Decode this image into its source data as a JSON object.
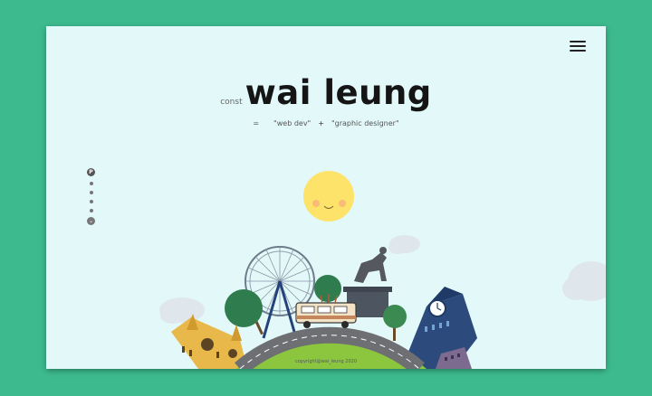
{
  "header": {
    "prefix": "const",
    "name": "wai leung",
    "equals": "=",
    "role1": "\"web dev\"",
    "plus": "+",
    "role2": "\"graphic designer\""
  },
  "nav": {
    "first_badge": "P",
    "section_count": 6,
    "down_glyph": "⌄"
  },
  "footer": {
    "copyright": "copyright@wai_leung 2020"
  },
  "colors": {
    "outer_bg": "#3dbb8f",
    "page_bg": "#e2f8f9",
    "sun": "#fde36a",
    "grass": "#8cc63f",
    "road": "#6d6f73"
  },
  "icons": [
    "hamburger-menu-icon",
    "sun-icon",
    "cloud-icon",
    "ferris-wheel-icon",
    "statue-icon",
    "clock-tower-icon",
    "car-icon",
    "tree-icon",
    "building-icon",
    "chevron-down-icon"
  ]
}
